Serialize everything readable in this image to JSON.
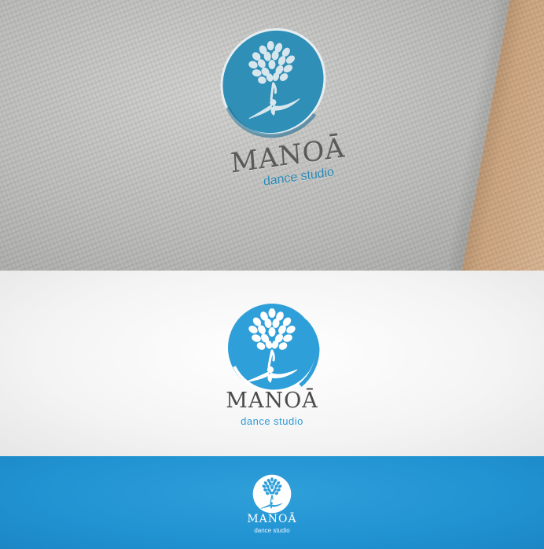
{
  "brand": {
    "name": "MANOĀ",
    "tagline": "dance studio"
  },
  "colors": {
    "brand_blue": "#2f9fd9",
    "paper_grey": "#bdbdbb",
    "wordmark_grey": "#4a4a4a",
    "banner_blue": "#2193d2",
    "white": "#ffffff"
  },
  "icons": {
    "logo_mark": "tree-with-dancer-in-circle-icon"
  },
  "panels": [
    {
      "id": "paper",
      "style": "embossed on textured paper"
    },
    {
      "id": "white",
      "style": "blue logo on white"
    },
    {
      "id": "blue",
      "style": "white logo on blue"
    }
  ]
}
